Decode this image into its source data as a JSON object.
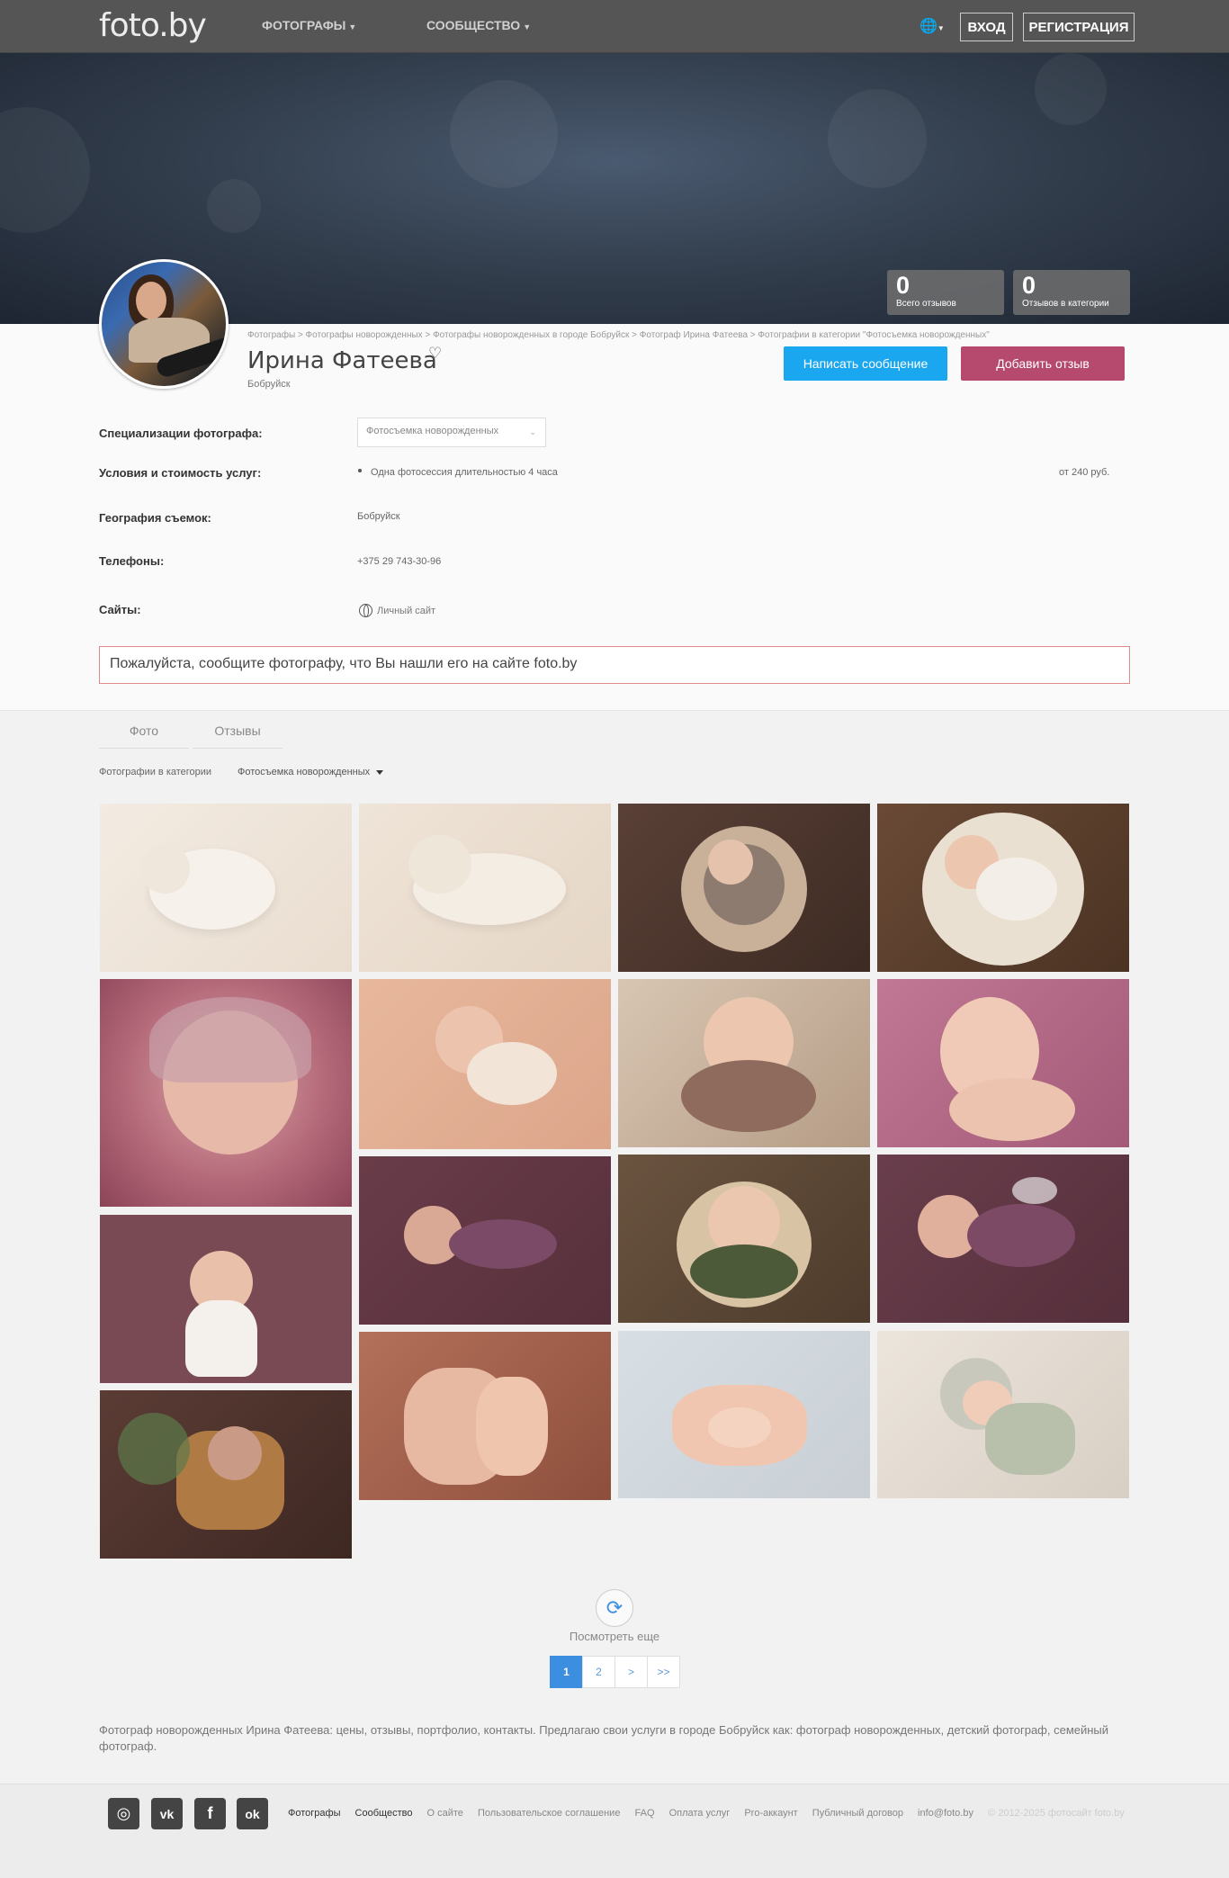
{
  "header": {
    "logo": "foto.by",
    "nav": [
      {
        "label": "ФОТОГРАФЫ"
      },
      {
        "label": "СООБЩЕСТВО"
      }
    ],
    "login": "ВХОД",
    "register": "РЕГИСТРАЦИЯ"
  },
  "stats": [
    {
      "value": "0",
      "label": "Всего отзывов"
    },
    {
      "value": "0",
      "label": "Отзывов в категории"
    }
  ],
  "profile": {
    "breadcrumb": "Фотографы > Фотографы новорожденных > Фотографы новорожденных в городе Бобруйск > Фотограф Ирина Фатеева > Фотографии в категории \"Фотосъемка новорожденных\"",
    "name": "Ирина Фатеева",
    "city": "Бобруйск",
    "write_message": "Написать сообщение",
    "add_review": "Добавить отзыв"
  },
  "details": {
    "spec_label": "Специализации фотографа:",
    "spec_value": "Фотосъемка новорожденных",
    "terms_label": "Условия и стоимость услуг:",
    "terms_item": "Одна фотосессия длительностью 4 часа",
    "terms_price": "от 240 руб.",
    "geo_label": "География съемок:",
    "geo_value": "Бобруйск",
    "phones_label": "Телефоны:",
    "phone": "+375 29 743-30-96",
    "sites_label": "Сайты:",
    "site_value": "Личный сайт",
    "notice": "Пожалуйста, сообщите фотографу, что Вы нашли его на сайте foto.by"
  },
  "tabs": [
    {
      "label": "Фото"
    },
    {
      "label": "Отзывы"
    }
  ],
  "category": {
    "label": "Фотографии в категории",
    "selected": "Фотосъемка новорожденных"
  },
  "more": {
    "label": "Посмотреть еще",
    "icon": "refresh-icon"
  },
  "pagination": [
    "1",
    "2",
    ">",
    ">>"
  ],
  "description": "Фотограф новорожденных Ирина Фатеева: цены, отзывы, портфолио, контакты. Предлагаю свои услуги в городе Бобруйск как: фотограф новорожденных, детский фотограф, семейный фотограф.",
  "footer": {
    "social": [
      {
        "name": "instagram-icon",
        "glyph": "◎"
      },
      {
        "name": "vk-icon",
        "glyph": "vk"
      },
      {
        "name": "facebook-icon",
        "glyph": "f"
      },
      {
        "name": "odnoklassniki-icon",
        "glyph": "ok"
      }
    ],
    "links": [
      "Фотографы",
      "Сообщество",
      "О сайте",
      "Пользовательское соглашение",
      "FAQ",
      "Оплата услуг",
      "Pro-аккаунт",
      "Публичный договор",
      "info@foto.by"
    ],
    "copyright": "© 2012-2025 фотосайт foto.by"
  },
  "colors": {
    "primary_button": "#1aa7f0",
    "review_button": "#b54a6e",
    "accent_blue": "#3c8ee0",
    "notice_border": "#e08a8a"
  }
}
